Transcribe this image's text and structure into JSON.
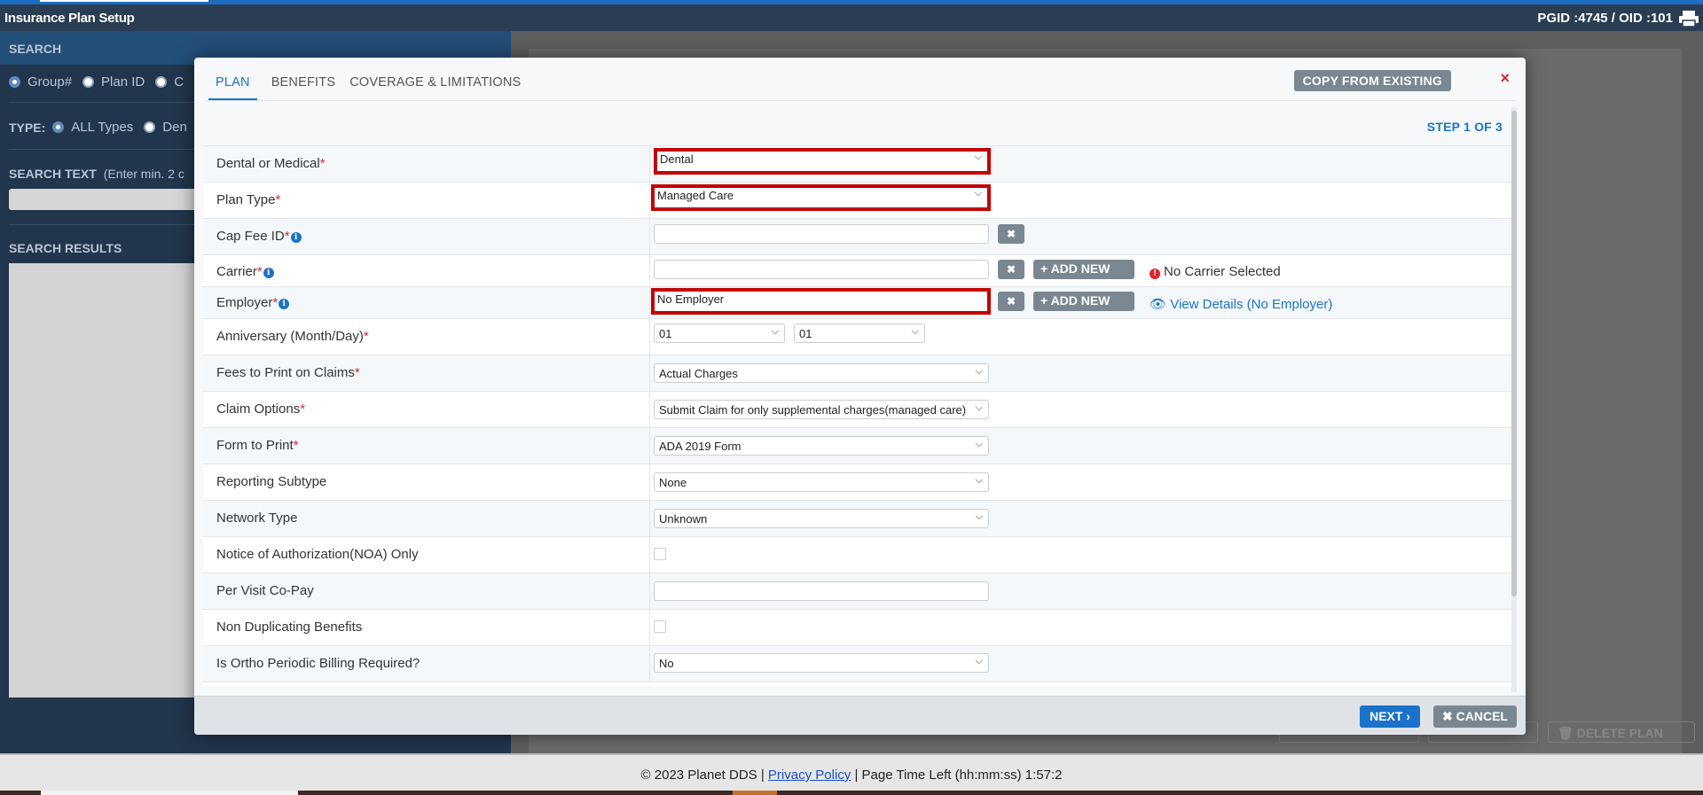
{
  "app": {
    "title": "Insurance Plan Setup",
    "ids": "PGID :4745  /  OID :101",
    "print_icon": "printer-icon"
  },
  "left": {
    "search_header": "SEARCH",
    "radio_row1": [
      "Group#",
      "Plan ID",
      "C"
    ],
    "type_label": "TYPE:",
    "type_options": [
      "ALL Types",
      "Den"
    ],
    "search_text_label": "SEARCH TEXT",
    "search_text_hint": "(Enter min. 2 c",
    "results_header": "SEARCH RESULTS"
  },
  "background_buttons": {
    "delete_plan": "DELETE PLAN"
  },
  "footer": {
    "copyright": "© 2023 Planet DDS |",
    "privacy": "Privacy Policy",
    "time": "|  Page Time Left (hh:mm:ss) 1:57:2"
  },
  "modal": {
    "tabs": [
      "PLAN",
      "BENEFITS",
      "COVERAGE & LIMITATIONS"
    ],
    "copy_button": "COPY FROM EXISTING",
    "close": "×",
    "step": "STEP 1 OF 3",
    "fields": {
      "dental_medical": {
        "label": "Dental or Medical",
        "value": "Dental"
      },
      "plan_type": {
        "label": "Plan Type",
        "value": "Managed Care"
      },
      "cap_fee": {
        "label": "Cap Fee ID",
        "value": ""
      },
      "carrier": {
        "label": "Carrier",
        "value": "",
        "add": "ADD NEW",
        "status": "No Carrier Selected"
      },
      "employer": {
        "label": "Employer",
        "value": "No Employer",
        "add": "ADD NEW",
        "link": "View Details (No Employer)"
      },
      "anniversary": {
        "label": "Anniversary (Month/Day)",
        "month": "01",
        "day": "01"
      },
      "fees": {
        "label": "Fees to Print on Claims",
        "value": "Actual Charges"
      },
      "claim_options": {
        "label": "Claim Options",
        "value": "Submit Claim for only supplemental charges(managed care)"
      },
      "form": {
        "label": "Form to Print",
        "value": "ADA 2019 Form"
      },
      "reporting": {
        "label": "Reporting Subtype",
        "value": "None"
      },
      "network": {
        "label": "Network Type",
        "value": "Unknown"
      },
      "noa": {
        "label": "Notice of Authorization(NOA) Only",
        "checked": false
      },
      "copay": {
        "label": "Per Visit Co-Pay",
        "value": ""
      },
      "nondup": {
        "label": "Non Duplicating Benefits",
        "checked": false
      },
      "ortho": {
        "label": "Is Ortho Periodic Billing Required?",
        "value": "No"
      }
    },
    "required_mark": "*",
    "next": "NEXT",
    "cancel": "CANCEL"
  }
}
